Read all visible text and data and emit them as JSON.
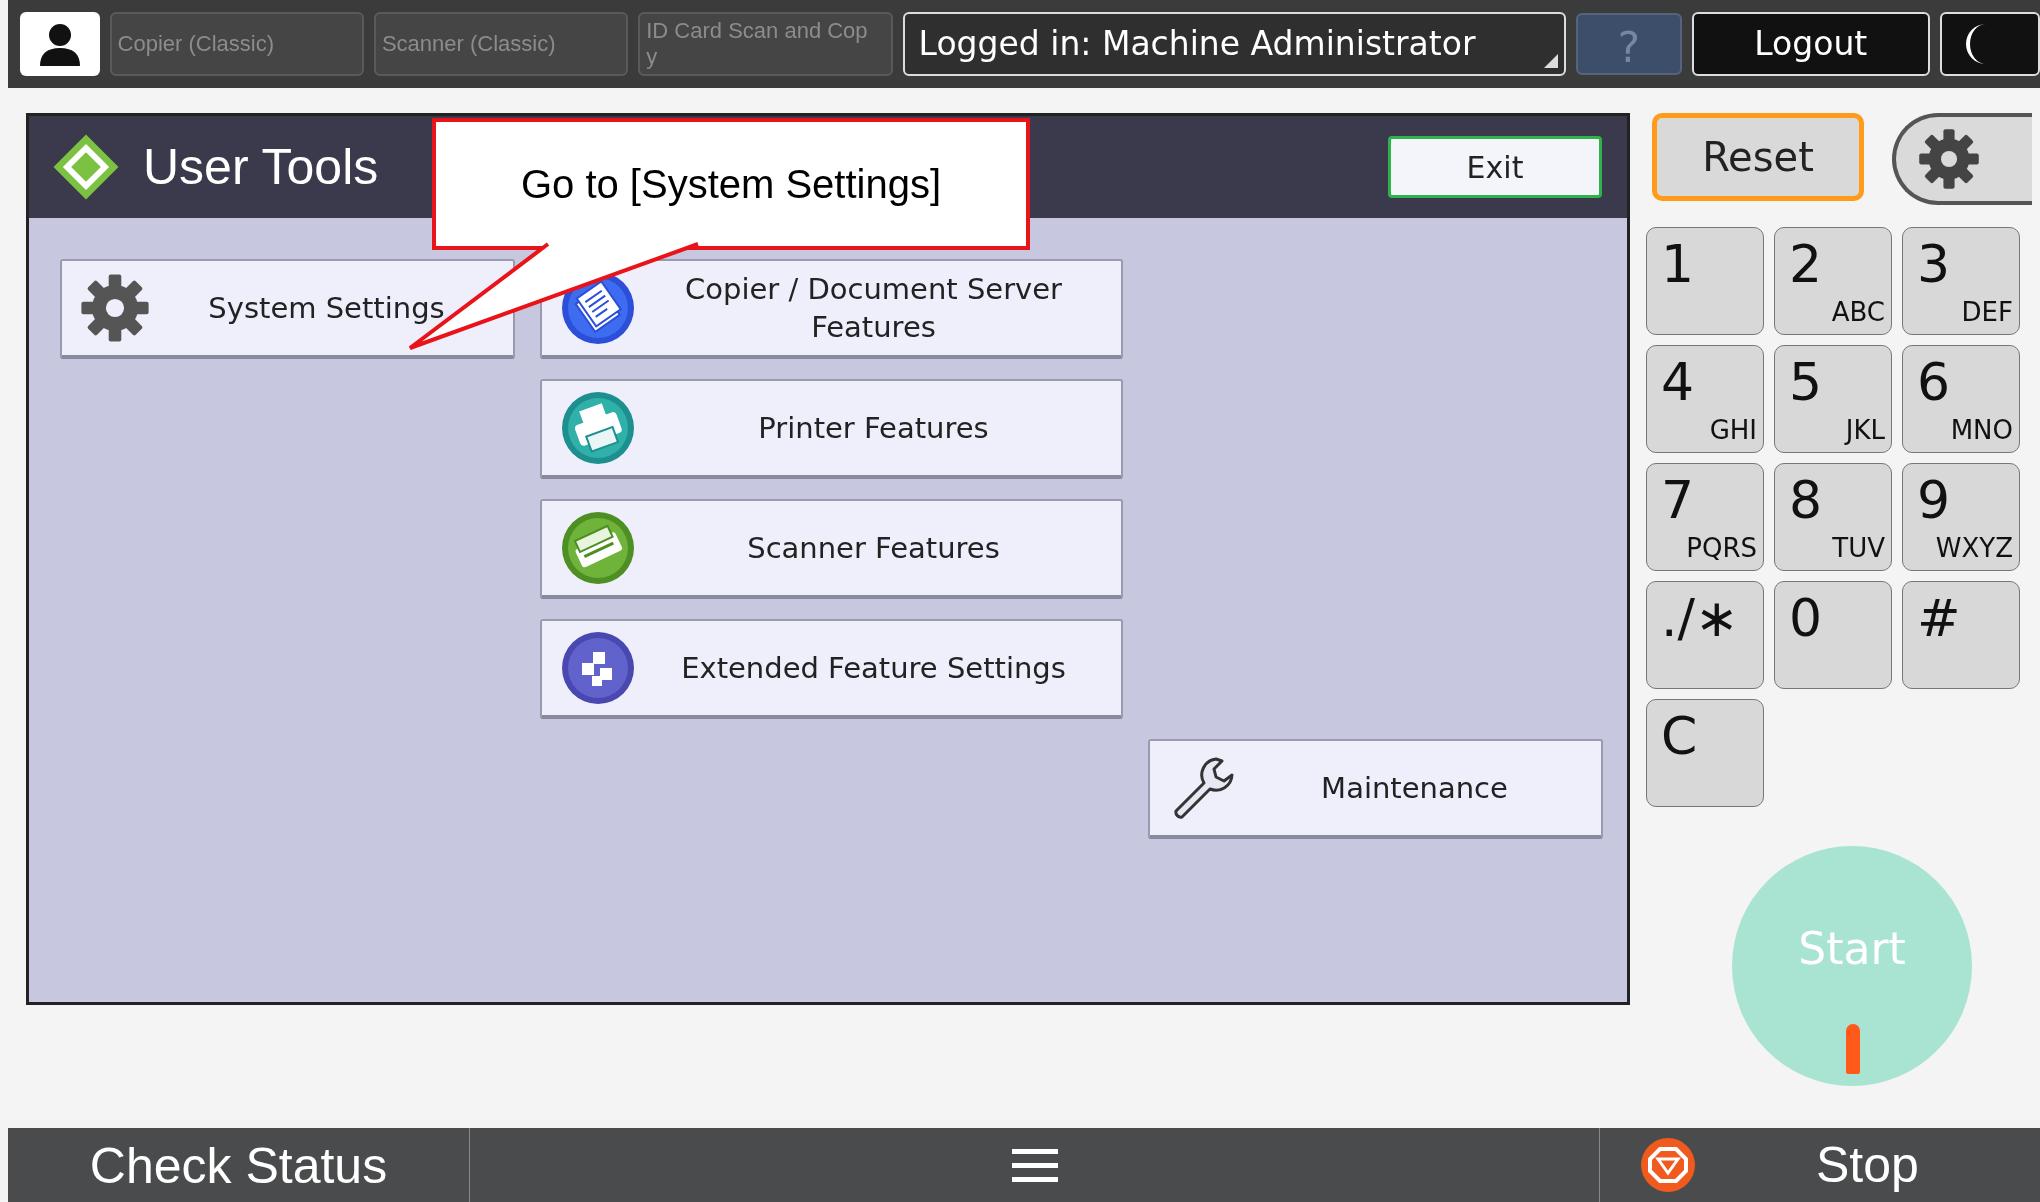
{
  "top_bar": {
    "tabs": [
      {
        "label": "Copier (Classic)",
        "disabled": true
      },
      {
        "label": "Scanner (Classic)",
        "disabled": true
      },
      {
        "label": "ID Card Scan and Cop\ny",
        "disabled": true
      }
    ],
    "login": "Logged in: Machine Administrator",
    "help": {
      "label": "?",
      "disabled": true
    },
    "logout": "Logout"
  },
  "panel": {
    "title": "User Tools",
    "exit": "Exit",
    "left_column": [
      {
        "label": "System Settings",
        "kind": "gear"
      }
    ],
    "middle_column": [
      {
        "label": "Copier / Document Server\nFeatures",
        "kind": "copier"
      },
      {
        "label": "Printer Features",
        "kind": "printer"
      },
      {
        "label": "Scanner Features",
        "kind": "scanner"
      },
      {
        "label": "Extended Feature Settings",
        "kind": "extended"
      }
    ],
    "right_column": [
      {
        "label": "Maintenance",
        "kind": "wrench"
      }
    ]
  },
  "callout": "Go to [System Settings]",
  "reset": "Reset",
  "keypad": [
    {
      "key": "1"
    },
    {
      "key": "2",
      "letters": "ABC"
    },
    {
      "key": "3",
      "letters": "DEF"
    },
    {
      "key": "4",
      "letters": "GHI"
    },
    {
      "key": "5",
      "letters": "JKL"
    },
    {
      "key": "6",
      "letters": "MNO"
    },
    {
      "key": "7",
      "letters": "PQRS"
    },
    {
      "key": "8",
      "letters": "TUV"
    },
    {
      "key": "9",
      "letters": "WXYZ"
    },
    {
      "key": "./∗"
    },
    {
      "key": "0"
    },
    {
      "key": "#"
    },
    {
      "key": "C"
    }
  ],
  "start": "Start",
  "bottom_bar": {
    "check_status": "Check Status",
    "stop": "Stop"
  }
}
